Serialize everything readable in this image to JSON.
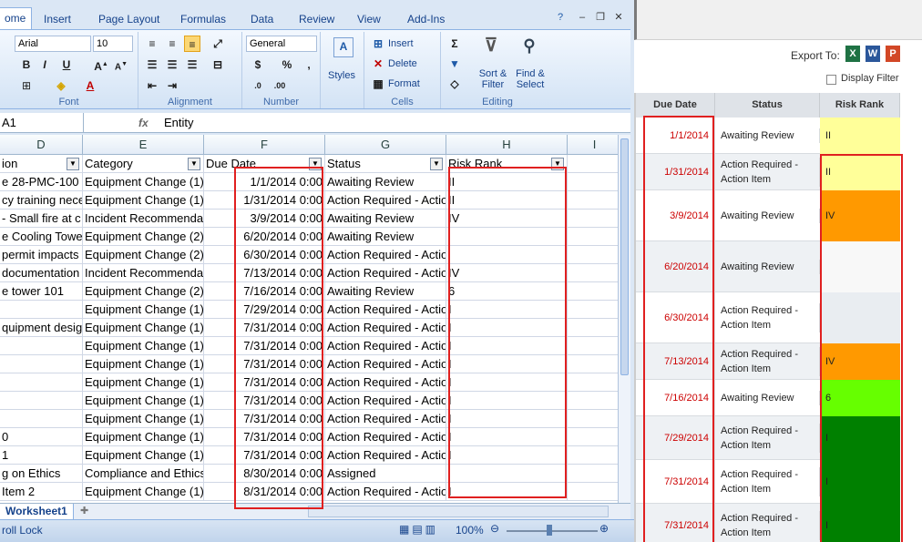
{
  "excel": {
    "ribbon_tabs": [
      "ome",
      "Insert",
      "Page Layout",
      "Formulas",
      "Data",
      "Review",
      "View",
      "Add-Ins"
    ],
    "font": {
      "name": "Arial",
      "size": "10"
    },
    "number_format": "General",
    "cells_buttons": {
      "insert": "Insert",
      "delete": "Delete",
      "format": "Format"
    },
    "editing_buttons": {
      "sort_filter": "Sort & Filter",
      "find_select": "Find & Select"
    },
    "styles_label": "Styles",
    "groups": {
      "font": "Font",
      "alignment": "Alignment",
      "number": "Number",
      "cells": "Cells",
      "editing": "Editing"
    },
    "name_box": "A1",
    "formula": "Entity",
    "columns": [
      "D",
      "E",
      "F",
      "G",
      "H",
      "I"
    ],
    "headers": {
      "d": "ion",
      "e": "Category",
      "f": "Due Date",
      "g": "Status",
      "h": "Risk Rank"
    },
    "rows": [
      {
        "d": "e 28-PMC-100 v",
        "e": "Equipment Change (1)",
        "f": "1/1/2014 0:00",
        "g": "Awaiting Review",
        "h": "II"
      },
      {
        "d": "cy training neces",
        "e": "Equipment Change (1)",
        "f": "1/31/2014 0:00",
        "g": "Action Required - Actio",
        "h": "II"
      },
      {
        "d": "- Small fire at c",
        "e": "Incident Recommenda",
        "f": "3/9/2014 0:00",
        "g": "Awaiting Review",
        "h": "IV"
      },
      {
        "d": "e Cooling Tower",
        "e": "Equipment Change (2)",
        "f": "6/20/2014 0:00",
        "g": "Awaiting Review",
        "h": ""
      },
      {
        "d": "permit impacts",
        "e": "Equipment Change (2)",
        "f": "6/30/2014 0:00",
        "g": "Action Required - Actio",
        "h": ""
      },
      {
        "d": "documentation",
        "e": "Incident Recommenda",
        "f": "7/13/2014 0:00",
        "g": "Action Required - Actio",
        "h": "IV"
      },
      {
        "d": "e tower 101",
        "e": "Equipment Change (2)",
        "f": "7/16/2014 0:00",
        "g": "Awaiting Review",
        "h": "6"
      },
      {
        "d": "",
        "e": "Equipment Change (1)",
        "f": "7/29/2014 0:00",
        "g": "Action Required - Actio",
        "h": "I"
      },
      {
        "d": "quipment design",
        "e": "Equipment Change (1)",
        "f": "7/31/2014 0:00",
        "g": "Action Required - Actio",
        "h": "I"
      },
      {
        "d": "",
        "e": "Equipment Change (1)",
        "f": "7/31/2014 0:00",
        "g": "Action Required - Actio",
        "h": "I"
      },
      {
        "d": "",
        "e": "Equipment Change (1)",
        "f": "7/31/2014 0:00",
        "g": "Action Required - Actio",
        "h": "I"
      },
      {
        "d": "",
        "e": "Equipment Change (1)",
        "f": "7/31/2014 0:00",
        "g": "Action Required - Actio",
        "h": "I"
      },
      {
        "d": "",
        "e": "Equipment Change (1)",
        "f": "7/31/2014 0:00",
        "g": "Action Required - Actio",
        "h": "I"
      },
      {
        "d": "",
        "e": "Equipment Change (1)",
        "f": "7/31/2014 0:00",
        "g": "Action Required - Actio",
        "h": "I"
      },
      {
        "d": "0",
        "e": "Equipment Change (1)",
        "f": "7/31/2014 0:00",
        "g": "Action Required - Actio",
        "h": "I"
      },
      {
        "d": "1",
        "e": "Equipment Change (1)",
        "f": "7/31/2014 0:00",
        "g": "Action Required - Actio",
        "h": "I"
      },
      {
        "d": "g on Ethics",
        "e": "Compliance and Ethics",
        "f": "8/30/2014 0:00",
        "g": "Assigned",
        "h": ""
      },
      {
        "d": "Item 2",
        "e": "Equipment Change (1)",
        "f": "8/31/2014 0:00",
        "g": "Action Required - Actio",
        "h": "I"
      }
    ],
    "sheet_tab": "Worksheet1",
    "status_left": "roll Lock",
    "zoom": "100%"
  },
  "web": {
    "export_label": "Export To:",
    "display_filter": "Display Filter",
    "headers": {
      "due": "Due Date",
      "status": "Status",
      "risk": "Risk Rank"
    },
    "rows": [
      {
        "due": "1/1/2014",
        "status": "Awaiting Review",
        "risk": "II",
        "color": "#ffff99"
      },
      {
        "due": "1/31/2014",
        "status": "Action Required - Action Item",
        "risk": "II",
        "color": "#ffff99"
      },
      {
        "due": "3/9/2014",
        "status": "Awaiting Review",
        "risk": "IV",
        "color": "#ff9900"
      },
      {
        "due": "6/20/2014",
        "status": "Awaiting Review",
        "risk": "",
        "color": "#f8f8f8"
      },
      {
        "due": "6/30/2014",
        "status": "Action Required - Action Item",
        "risk": "",
        "color": "#e9edf1"
      },
      {
        "due": "7/13/2014",
        "status": "Action Required - Action Item",
        "risk": "IV",
        "color": "#ff9900"
      },
      {
        "due": "7/16/2014",
        "status": "Awaiting Review",
        "risk": "6",
        "color": "#66ff00"
      },
      {
        "due": "7/29/2014",
        "status": "Action Required - Action Item",
        "risk": "I",
        "color": "#008000"
      },
      {
        "due": "7/31/2014",
        "status": "Action Required - Action Item",
        "risk": "I",
        "color": "#008000"
      },
      {
        "due": "7/31/2014",
        "status": "Action Required - Action Item",
        "risk": "I",
        "color": "#008000"
      }
    ]
  }
}
